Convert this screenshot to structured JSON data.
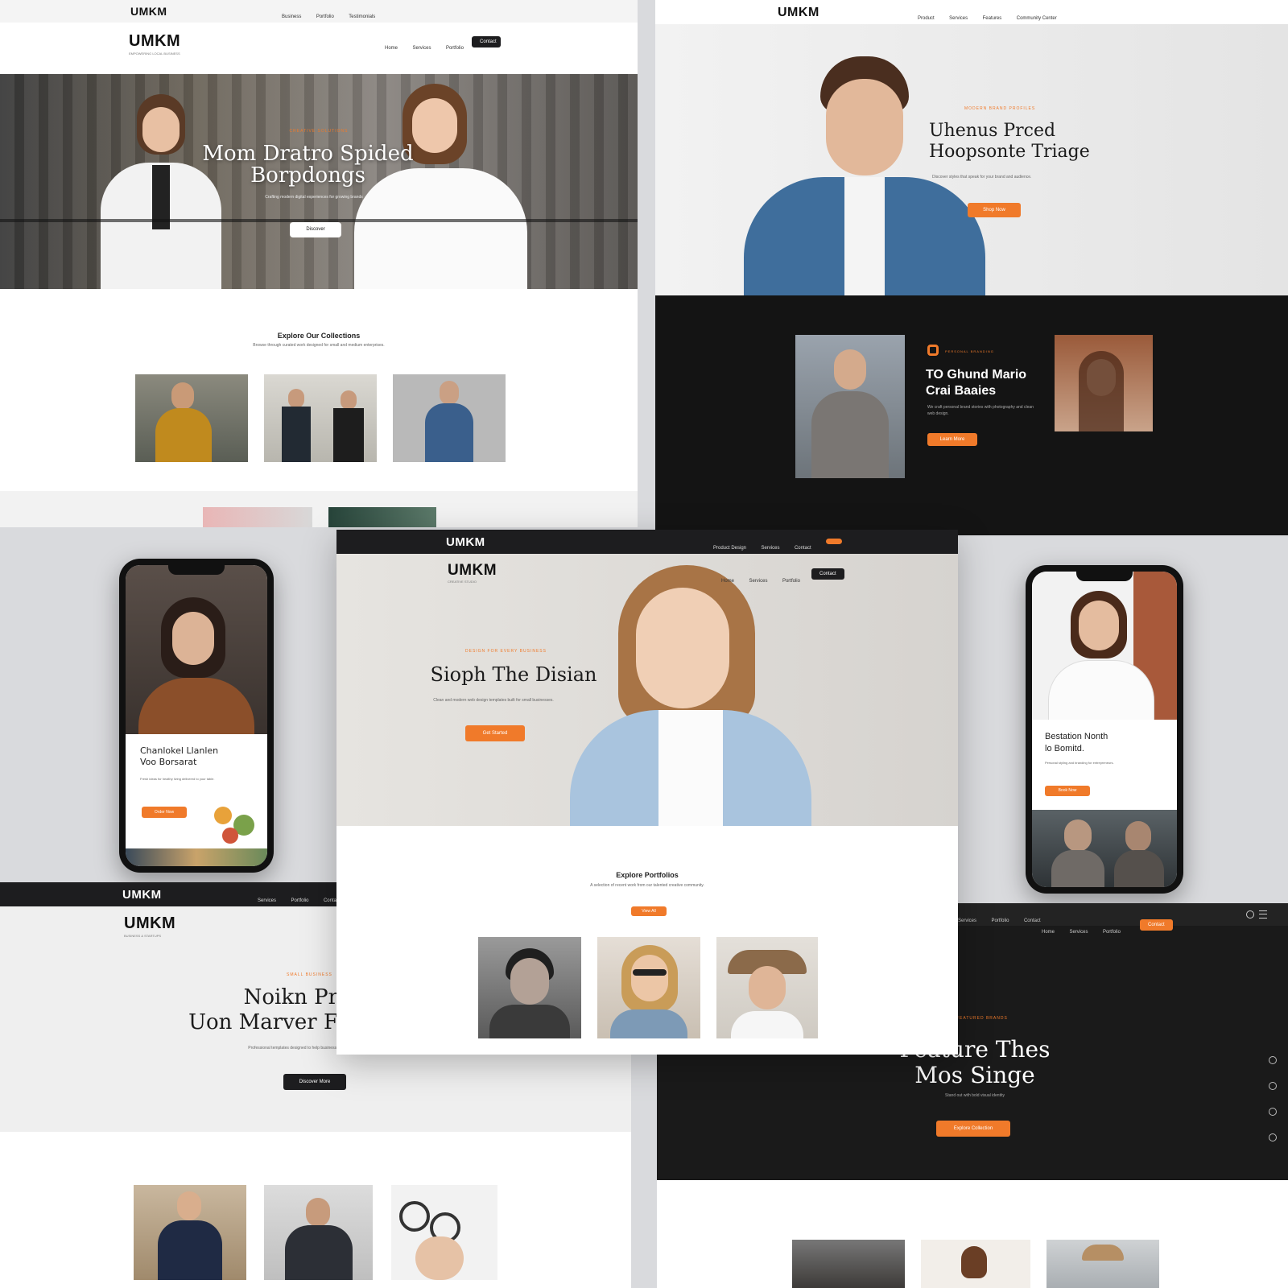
{
  "mockups": {
    "top_left": {
      "topbar": {
        "logo": "UMKM",
        "nav": [
          "Business",
          "Portfolio",
          "Testimonials"
        ]
      },
      "header": {
        "logo": "UMKM",
        "tagline": "EMPOWERING LOCAL BUSINESS",
        "nav": [
          "Home",
          "Services",
          "Portfolio"
        ],
        "cta": "Contact"
      },
      "hero": {
        "kicker": "CREATIVE SOLUTIONS",
        "title_line1": "Mom Dratro Spided",
        "title_line2": "Borpdongs",
        "subtitle": "Crafting modern digital experiences for growing brands",
        "button": "Discover"
      },
      "features": {
        "title": "Explore Our Collections",
        "subtitle": "Browse through curated work designed for small and medium enterprises."
      }
    },
    "top_right": {
      "topbar": {
        "logo": "UMKM",
        "nav": [
          "Product",
          "Services",
          "Features",
          "Community Center"
        ]
      },
      "hero": {
        "kicker": "MODERN BRAND PROFILES",
        "title_line1": "Uhenus Prced",
        "title_line2": "Hoopsonte Triage",
        "subtitle": "Discover styles that speak for your brand and audience.",
        "button": "Shop Now"
      },
      "dark": {
        "kicker": "PERSONAL BRANDING",
        "title_line1": "TO Ghund Mario",
        "title_line2": "Crai Baaies",
        "subtitle": "We craft personal brand stories with photography and clean web design.",
        "button": "Learn More"
      }
    },
    "left_phone": {
      "title_line1": "Chanlokel Llanlen",
      "title_line2": "Voo Borsarat",
      "subtitle": "Fresh ideas for healthy living delivered to your table.",
      "button": "Order Now"
    },
    "center": {
      "topbar": {
        "logo": "UMKM",
        "nav": [
          "Product Design",
          "Services",
          "Contact"
        ]
      },
      "header": {
        "logo": "UMKM",
        "tagline": "CREATIVE STUDIO",
        "nav": [
          "Home",
          "Services",
          "Portfolio"
        ],
        "cta": "Contact"
      },
      "hero": {
        "kicker": "DESIGN FOR EVERY BUSINESS",
        "title": "Sioph The Disian",
        "subtitle": "Clean and modern web design templates built for small businesses.",
        "button": "Get Started"
      },
      "features": {
        "title": "Explore Portfolios",
        "subtitle": "A selection of recent work from our talented creative community.",
        "button": "View All"
      }
    },
    "right_phone": {
      "title_line1": "Bestation Nonth",
      "title_line2": "lo Bomitd.",
      "subtitle": "Personal styling and branding for entrepreneurs.",
      "button": "Book Now"
    },
    "bottom_left": {
      "topbar": {
        "logo": "UMKM",
        "nav": [
          "Services",
          "Portfolio",
          "Contact"
        ]
      },
      "header": {
        "logo": "UMKM",
        "tagline": "BUSINESS & STARTUPS"
      },
      "hero": {
        "kicker": "SMALL BUSINESS",
        "title_line1": "Noikn Pr",
        "title_line2": "Uon Marver F",
        "subtitle": "Professional templates designed to help businesses grow online.",
        "button": "Discover More"
      }
    },
    "bottom_right": {
      "topbar": {
        "nav": [
          "Services",
          "Portfolio",
          "Contact"
        ]
      },
      "header": {
        "nav": [
          "Home",
          "Services",
          "Portfolio"
        ],
        "cta": "Contact"
      },
      "hero": {
        "kicker": "FEATURED BRANDS",
        "title_line1": "Feature Thes",
        "title_line2": "Mos Singe",
        "subtitle": "Stand out with bold visual identity",
        "button": "Explore Collection"
      }
    }
  },
  "colors": {
    "accent": "#f07a2a",
    "dark": "#1d1d1f",
    "light_bg": "#eeeeee"
  }
}
